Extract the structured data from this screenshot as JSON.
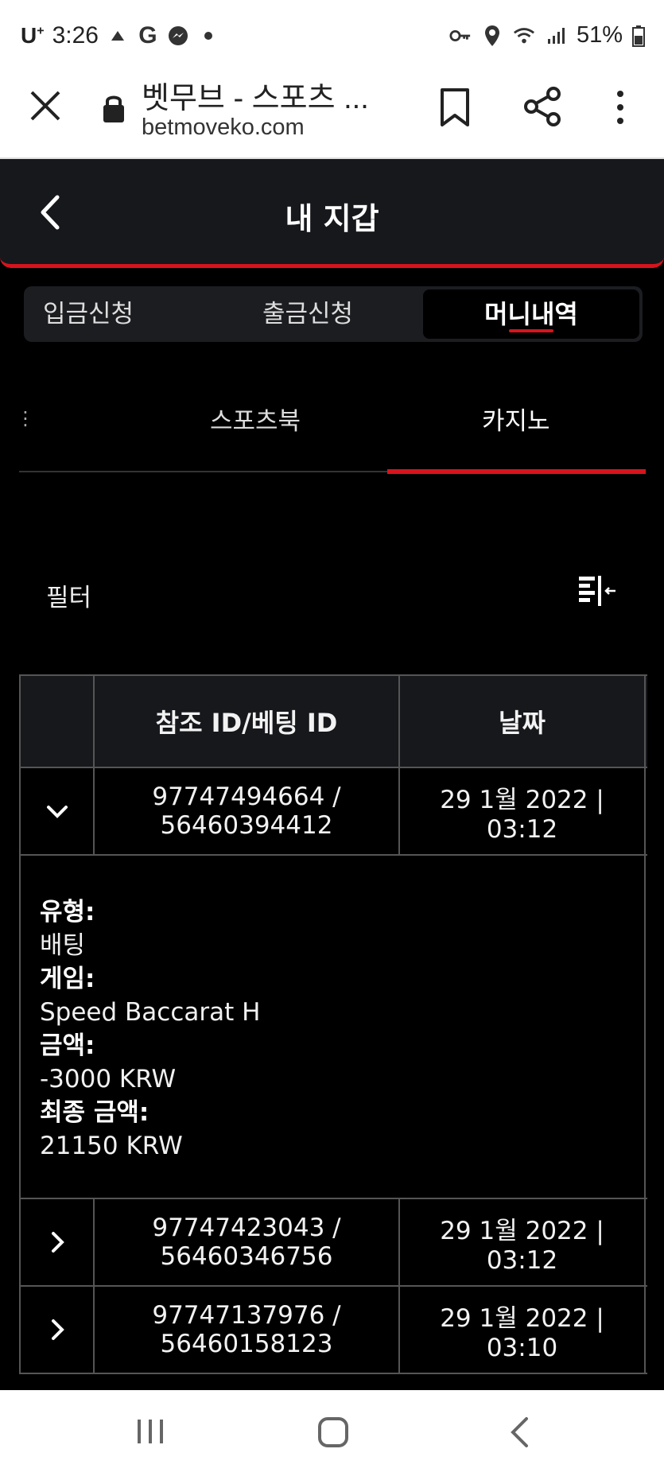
{
  "status_bar": {
    "carrier": "U",
    "carrier_sup": "+",
    "time": "3:26",
    "battery": "51%"
  },
  "browser": {
    "title": "벳무브 - 스포츠 ...",
    "url": "betmoveko.com"
  },
  "header": {
    "title": "내 지갑"
  },
  "main_tabs": [
    {
      "label": "입금신청"
    },
    {
      "label": "출금신청"
    },
    {
      "label": "머니내역"
    }
  ],
  "sub_tabs": [
    {
      "label": "⋮"
    },
    {
      "label": "스포츠북"
    },
    {
      "label": "카지노"
    }
  ],
  "filter": {
    "label": "필터"
  },
  "table": {
    "columns": [
      "",
      "참조 ID/베팅 ID",
      "날짜"
    ],
    "rows": [
      {
        "ref_id": "97747494664 /",
        "bet_id": "56460394412",
        "date": "29 1월 2022 |",
        "time": "03:12",
        "expanded": true
      },
      {
        "ref_id": "97747423043 /",
        "bet_id": "56460346756",
        "date": "29 1월 2022 |",
        "time": "03:12",
        "expanded": false
      },
      {
        "ref_id": "97747137976 /",
        "bet_id": "56460158123",
        "date": "29 1월 2022 |",
        "time": "03:10",
        "expanded": false
      }
    ],
    "detail": {
      "type_label": "유형:",
      "type_value": "배팅",
      "game_label": "게임:",
      "game_value": "Speed Baccarat H",
      "amount_label": "금액:",
      "amount_value": "-3000 KRW",
      "final_label": "최종 금액:",
      "final_value": "21150 KRW"
    }
  },
  "colors": {
    "accent": "#d6141d",
    "header_bg": "#17181c",
    "background": "#000000"
  }
}
